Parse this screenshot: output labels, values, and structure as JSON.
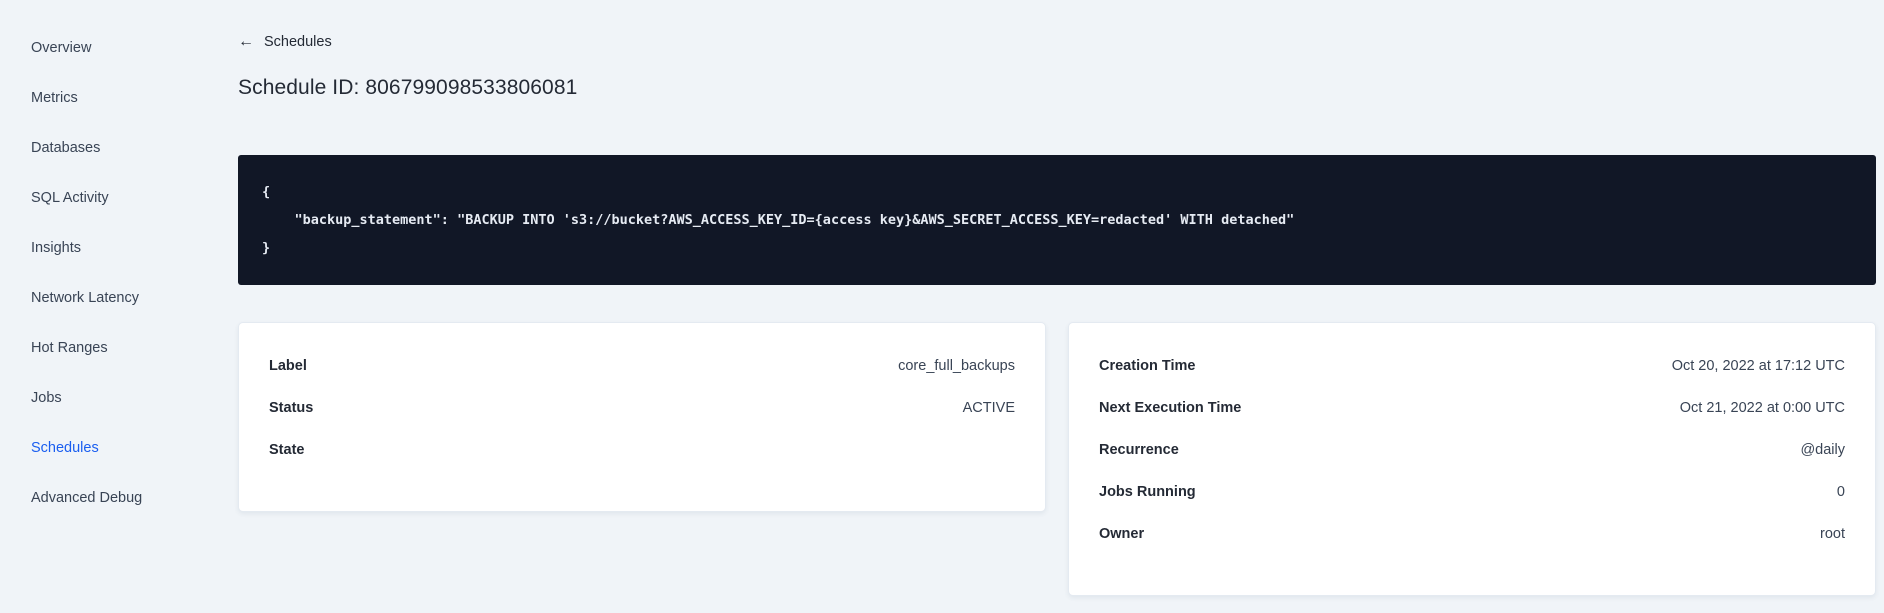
{
  "colors": {
    "accent_blue": "#1a5ef0",
    "page_background": "#f0f4f8",
    "code_background": "#111726",
    "code_text": "#e6ebf3",
    "text_dark": "#242a35",
    "text_slate": "#394455"
  },
  "sidebar": {
    "items": [
      {
        "label": "Overview",
        "active": false
      },
      {
        "label": "Metrics",
        "active": false
      },
      {
        "label": "Databases",
        "active": false
      },
      {
        "label": "SQL Activity",
        "active": false
      },
      {
        "label": "Insights",
        "active": false
      },
      {
        "label": "Network Latency",
        "active": false
      },
      {
        "label": "Hot Ranges",
        "active": false
      },
      {
        "label": "Jobs",
        "active": false
      },
      {
        "label": "Schedules",
        "active": true
      },
      {
        "label": "Advanced Debug",
        "active": false
      }
    ]
  },
  "header": {
    "back_icon": "←",
    "back_label": "Schedules",
    "title": "Schedule ID: 806799098533806081"
  },
  "code_block": {
    "lines": [
      "{",
      "    \"backup_statement\": \"BACKUP INTO 's3://bucket?AWS_ACCESS_KEY_ID={access key}&AWS_SECRET_ACCESS_KEY=redacted' WITH detached\"",
      "}"
    ]
  },
  "cards": {
    "details": {
      "rows": [
        {
          "term": "Label",
          "value": "core_full_backups"
        },
        {
          "term": "Status",
          "value": "ACTIVE"
        },
        {
          "term": "State",
          "value": ""
        }
      ]
    },
    "execution": {
      "rows": [
        {
          "term": "Creation Time",
          "value": "Oct 20, 2022 at 17:12 UTC"
        },
        {
          "term": "Next Execution Time",
          "value": "Oct 21, 2022 at 0:00 UTC"
        },
        {
          "term": "Recurrence",
          "value": "@daily"
        },
        {
          "term": "Jobs Running",
          "value": "0"
        },
        {
          "term": "Owner",
          "value": "root"
        }
      ]
    }
  }
}
